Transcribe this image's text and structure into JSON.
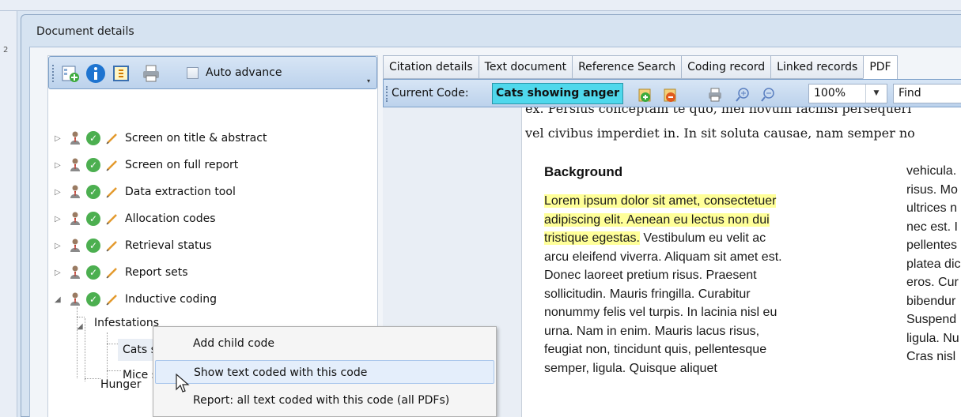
{
  "dialog": {
    "title": "Document details"
  },
  "left_toolbar": {
    "auto_advance_label": "Auto advance"
  },
  "tree": {
    "items": [
      {
        "label": "Screen on title & abstract"
      },
      {
        "label": "Screen on full report"
      },
      {
        "label": "Data extraction tool"
      },
      {
        "label": "Allocation codes"
      },
      {
        "label": "Retrieval status"
      },
      {
        "label": "Report sets"
      },
      {
        "label": "Inductive coding"
      }
    ],
    "child": {
      "label": "Infestations"
    },
    "grandchildren": [
      {
        "label": "Cats showing anger"
      },
      {
        "label": "Mice s"
      }
    ],
    "sibling": {
      "label": "Hunger"
    }
  },
  "context_menu": {
    "items": [
      {
        "label": "Add child code"
      },
      {
        "label": "Show text coded with this code"
      },
      {
        "label": "Report: all text coded with this code (all PDFs)"
      }
    ]
  },
  "tabs": [
    {
      "label": "Citation details"
    },
    {
      "label": "Text document"
    },
    {
      "label": "Reference Search"
    },
    {
      "label": "Coding record"
    },
    {
      "label": "Linked records"
    },
    {
      "label": "PDF",
      "active": true
    }
  ],
  "pdf_toolbar": {
    "current_code_label": "Current Code:",
    "current_code_value": "Cats showing anger",
    "zoom": "100%",
    "find_placeholder": "Find"
  },
  "document": {
    "top_lines": [
      "ex. Persius conceptam te quo, mel novum facilisi persequeri",
      "vel civibus imperdiet in. In sit soluta causae, nam semper no"
    ],
    "heading": "Background",
    "highlight_lines": [
      "Lorem ipsum dolor sit amet, consectetuer",
      "adipiscing elit. Aenean eu lectus non dui",
      "tristique egestas."
    ],
    "line3_rest": " Vestibulum eu velit ac",
    "body_lines": [
      "arcu eleifend viverra. Aliquam sit amet est.",
      "Donec laoreet pretium risus. Praesent",
      "sollicitudin. Mauris fringilla. Curabitur",
      "nonummy felis vel turpis. In lacinia nisl eu",
      "urna. Nam in enim. Mauris lacus risus,",
      "feugiat non, tincidunt quis, pellentesque",
      "semper, ligula. Quisque aliquet"
    ],
    "col2_lines": [
      "vehicula.",
      "risus. Mo",
      "ultrices n",
      "nec est. I",
      "pellentes",
      "platea dic",
      "eros. Cur",
      "bibendur",
      "Suspend",
      "ligula. Nu",
      "Cras nisl"
    ]
  },
  "colors": {
    "current_code_bg": "#4fd8ec",
    "highlight": "#ffff99",
    "toolbar": "#bcd2ec",
    "check": "#4caf50"
  }
}
